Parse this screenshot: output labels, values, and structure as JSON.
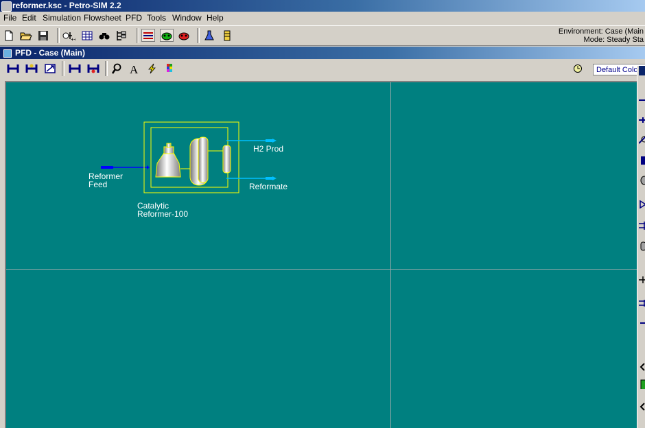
{
  "app": {
    "title": "reformer.ksc - Petro-SIM 2.2"
  },
  "menu": [
    "File",
    "Edit",
    "Simulation",
    "Flowsheet",
    "PFD",
    "Tools",
    "Window",
    "Help"
  ],
  "status": {
    "environment": "Environment: Case (Main",
    "mode": "Mode: Steady Sta"
  },
  "pfd": {
    "window_title": "PFD - Case (Main)",
    "color_scheme": "Default Colo",
    "streams": {
      "feed_line1": "Reformer",
      "feed_line2": "Feed",
      "h2": "H2 Prod",
      "reformate": "Reformate"
    },
    "unit": {
      "line1": "Catalytic",
      "line2": "Reformer-100"
    }
  },
  "colors": {
    "canvas": "#008080",
    "stream": "#0000ff",
    "product_stream": "#00bfff",
    "unit_border": "#ffff00"
  }
}
